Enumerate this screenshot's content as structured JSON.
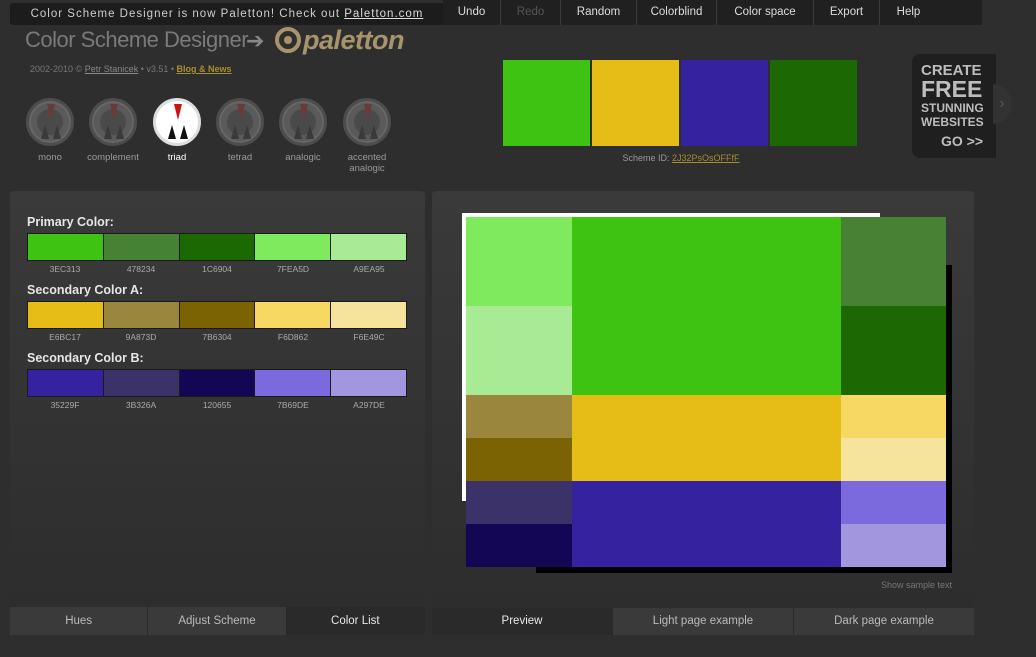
{
  "header": {
    "announce_text": "Color Scheme Designer is now Paletton! Check out ",
    "announce_link": "Paletton.com",
    "app_title": "Color Scheme Designer",
    "arrow": "➔",
    "logo_word": "paletton",
    "credits_prefix": "2002-2010 © ",
    "credits_author": "Petr Stanicek",
    "credits_version": " • v3.51 • ",
    "credits_blog": "Blog & News"
  },
  "scheme_types": [
    {
      "label": "mono",
      "active": false
    },
    {
      "label": "complement",
      "active": false
    },
    {
      "label": "triad",
      "active": true
    },
    {
      "label": "tetrad",
      "active": false
    },
    {
      "label": "analogic",
      "active": false
    },
    {
      "label": "accented analogic",
      "active": false
    }
  ],
  "toolbar": [
    "Undo",
    "Redo",
    "Random",
    "Colorblind",
    "Color space",
    "Export",
    "Help"
  ],
  "scheme_preview": [
    "#3EC313",
    "#E6BC17",
    "#35229F",
    "#1C6904"
  ],
  "scheme_id": {
    "label": "Scheme ID: ",
    "value": "2J32PsOsOFFfF"
  },
  "ad": {
    "line1": "CREATE",
    "line2": "FREE",
    "line3": "STUNNING",
    "line4": "WEBSITES",
    "line5": "GO >>"
  },
  "color_list": {
    "primary": {
      "title": "Primary Color:",
      "codes": [
        "3EC313",
        "478234",
        "1C6904",
        "7FEA5D",
        "A9EA95"
      ]
    },
    "secondary_a": {
      "title": "Secondary Color A:",
      "codes": [
        "E6BC17",
        "9A873D",
        "7B6304",
        "F6D862",
        "F6E49C"
      ]
    },
    "secondary_b": {
      "title": "Secondary Color B:",
      "codes": [
        "35229F",
        "3B326A",
        "120655",
        "7B69DE",
        "A297DE"
      ]
    }
  },
  "left_tabs": [
    "Hues",
    "Adjust Scheme",
    "Color List"
  ],
  "preview": {
    "show_sample": "Show sample text",
    "cells": [
      {
        "color": "#7FEA5D"
      },
      {
        "color": "#A9EA95"
      },
      {
        "color": "#9A873D"
      },
      {
        "color": "#7B6304"
      },
      {
        "color": "#3B326A"
      },
      {
        "color": "#120655"
      },
      {
        "color": "#3EC313"
      },
      {
        "color": "#E6BC17"
      },
      {
        "color": "#35229F"
      },
      {
        "color": "#478234"
      },
      {
        "color": "#1C6904"
      },
      {
        "color": "#F6D862"
      },
      {
        "color": "#F6E49C"
      },
      {
        "color": "#7B69DE"
      },
      {
        "color": "#A297DE"
      }
    ]
  },
  "right_tabs": [
    "Preview",
    "Light page example",
    "Dark page example"
  ]
}
